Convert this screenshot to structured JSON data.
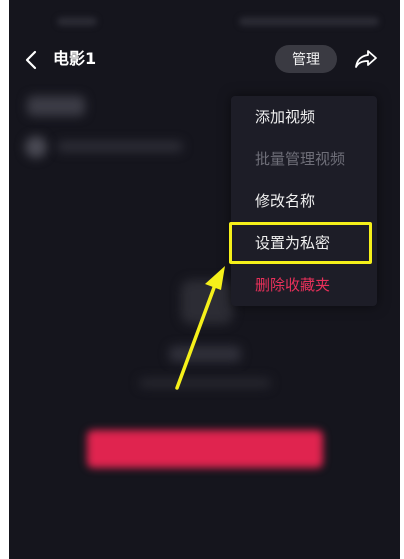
{
  "header": {
    "title": "电影1",
    "manage_label": "管理"
  },
  "menu": {
    "items": [
      {
        "label": "添加视频",
        "state": "enabled"
      },
      {
        "label": "批量管理视频",
        "state": "disabled"
      },
      {
        "label": "修改名称",
        "state": "enabled"
      },
      {
        "label": "设置为私密",
        "state": "highlighted"
      },
      {
        "label": "删除收藏夹",
        "state": "destructive"
      }
    ]
  },
  "icons": {
    "back": "chevron-left-icon",
    "share": "share-arrow-icon"
  },
  "colors": {
    "background": "#15151d",
    "menu_background": "#1d1d27",
    "destructive": "#e8305a",
    "highlight": "#f5f01a",
    "primary_button": "#e0244f"
  }
}
